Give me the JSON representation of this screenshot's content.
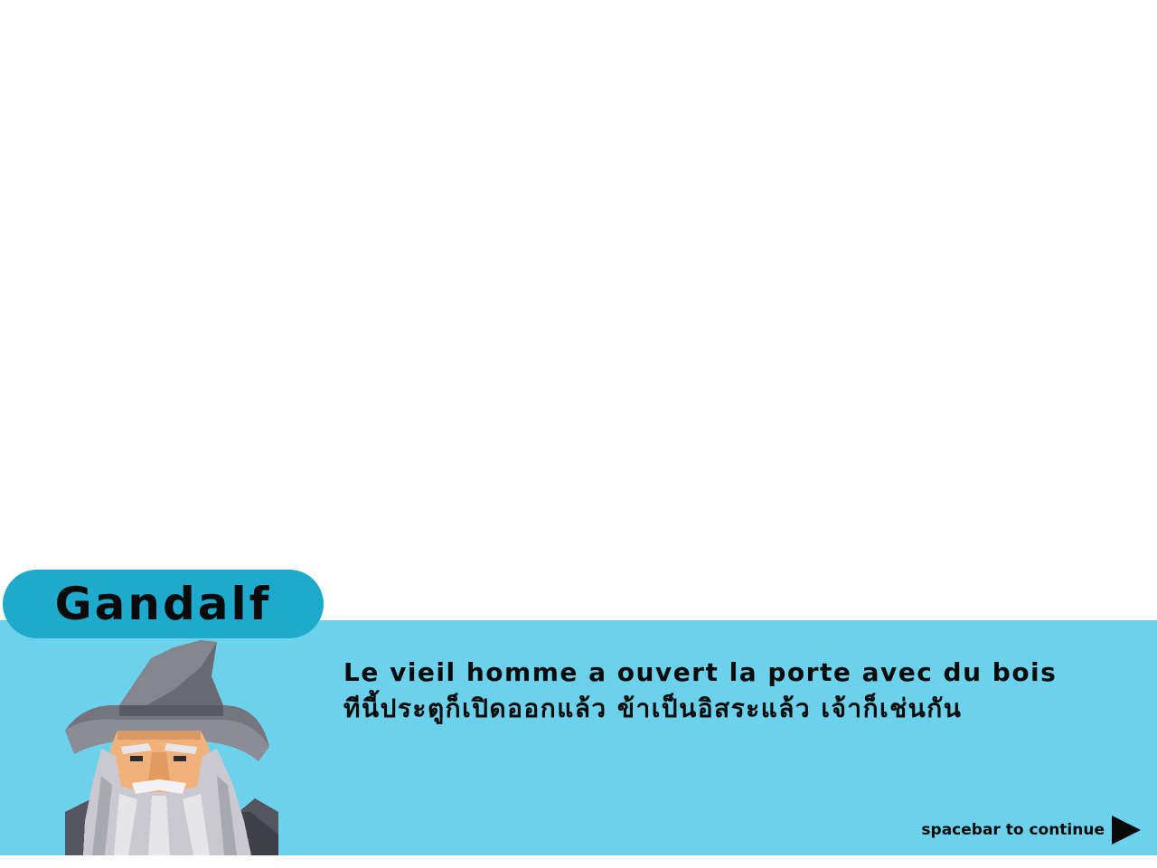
{
  "speaker": {
    "name": "Gandalf",
    "portrait_icon": "wizard-portrait"
  },
  "dialog": {
    "lines": [
      "Le vieil homme a ouvert la porte avec du bois",
      "ทีนี้ประตูก็เปิดออกแล้ว ข้าเป็นอิสระแล้ว เจ้าก็เช่นกัน"
    ]
  },
  "prompt": {
    "continue_label": "spacebar to continue",
    "continue_icon": "play-arrow-icon"
  },
  "colors": {
    "background": "#ffffff",
    "dialog_panel": "#6cd1ea",
    "name_plate": "#1eaacd",
    "text": "#0a0a0a"
  }
}
